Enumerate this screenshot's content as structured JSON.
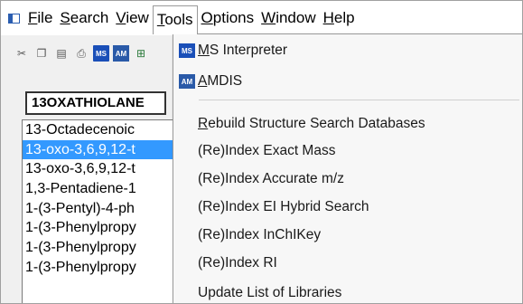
{
  "menubar": {
    "items": [
      {
        "label_u": "F",
        "label_rest": "ile"
      },
      {
        "label_u": "S",
        "label_rest": "earch"
      },
      {
        "label_u": "V",
        "label_rest": "iew"
      },
      {
        "label_u": "T",
        "label_rest": "ools"
      },
      {
        "label_u": "O",
        "label_rest": "ptions"
      },
      {
        "label_u": "W",
        "label_rest": "indow"
      },
      {
        "label_u": "H",
        "label_rest": "elp"
      }
    ]
  },
  "toolbar": {
    "ms_icon_text": "MS",
    "am_icon_text": "AM"
  },
  "search": {
    "value": "13OXATHIOLANE"
  },
  "list": {
    "items": [
      "13-Octadecenoic",
      "13-oxo-3,6,9,12-t",
      "13-oxo-3,6,9,12-t",
      "1,3-Pentadiene-1",
      "1-(3-Pentyl)-4-ph",
      "1-(3-Phenylpropy",
      "1-(3-Phenylpropy",
      "1-(3-Phenylpropy"
    ],
    "selected_index": 1
  },
  "tools_menu": {
    "ms_interpreter": {
      "u": "M",
      "rest": "S Interpreter"
    },
    "amdis": {
      "u": "A",
      "rest": "MDIS"
    },
    "items": [
      {
        "u": "R",
        "rest": "ebuild Structure Search Databases"
      },
      {
        "u": "",
        "rest": "(Re)Index Exact Mass"
      },
      {
        "u": "",
        "rest": "(Re)Index Accurate m/z"
      },
      {
        "u": "",
        "rest": "(Re)Index EI Hybrid Search"
      },
      {
        "u": "",
        "rest": "(Re)Index InChIKey"
      },
      {
        "u": "",
        "rest": "(Re)Index RI"
      },
      {
        "u": "",
        "rest": "Update List of Libraries"
      }
    ]
  }
}
